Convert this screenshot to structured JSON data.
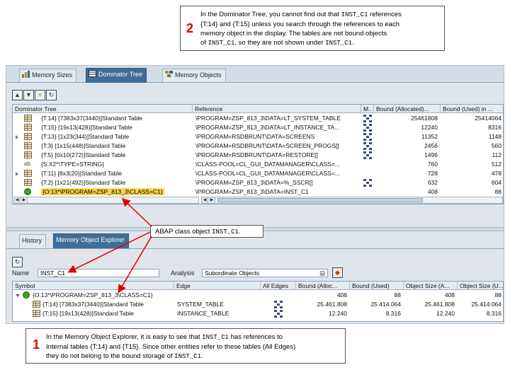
{
  "callout_top": {
    "number": "2",
    "lines": [
      [
        "In the Dominator Tree, you cannot find out that ",
        {
          "mono": "INST_C1"
        },
        " references"
      ],
      [
        "{T:14} and {T:15} unless you search through the references to each"
      ],
      [
        "memory object in the display. The tables are not bound objects"
      ],
      [
        "of ",
        {
          "mono": "INST_C1"
        },
        ", so they are not shown under ",
        {
          "mono": "INST_C1"
        },
        "."
      ]
    ]
  },
  "callout_middle": {
    "lines": [
      [
        "ABAP class object ",
        {
          "mono": "INST_C1"
        },
        "."
      ]
    ]
  },
  "callout_bottom": {
    "number": "1",
    "lines": [
      [
        "In the Memory Object Explorer, it is easy to see that ",
        {
          "mono": "INST_C1"
        },
        " has references to"
      ],
      [
        "Internal tables {T:14} and {T15}.  Since other entities refer to these tables (All Edges)"
      ],
      [
        "they do not belong to the bound storage of  ",
        {
          "mono": "INST_C1"
        },
        "."
      ]
    ]
  },
  "top_tabs": [
    {
      "label": "Memory Sizes",
      "active": false
    },
    {
      "label": "Dominator Tree",
      "active": true
    },
    {
      "label": "Memory Objects",
      "active": false
    }
  ],
  "dominator": {
    "headers": [
      "Dominator Tree",
      "Reference",
      "M..",
      "Bound (Allocated)...",
      "Bound (Used) in ..."
    ],
    "rows": [
      {
        "icon": "table",
        "expand": false,
        "name": "{T:14} [7383x37(3440)]Standard Table",
        "ref": "\\PROGRAM=ZSP_813_3\\DATA=LT_SYSTEM_TABLE",
        "net": true,
        "alloc": "25461808",
        "used": "25414064"
      },
      {
        "icon": "table",
        "expand": false,
        "name": "{T:15} [19x13(428)]Standard Table",
        "ref": "\\PROGRAM=ZSP_813_3\\DATA=LT_INSTANCE_TA...",
        "net": true,
        "alloc": "12240",
        "used": "8316"
      },
      {
        "icon": "table",
        "expand": true,
        "name": "{T:13} [1x23(344)]Standard Table",
        "ref": "\\PROGRAM=RSDBRUNT\\DATA=SCREENS",
        "net": true,
        "alloc": "11352",
        "used": "1148"
      },
      {
        "icon": "table",
        "expand": false,
        "name": "{T:3} [1x15(448)]Standard Table",
        "ref": "\\PROGRAM=RSDBRUNT\\DATA=SCREEN_PROGS[]",
        "net": true,
        "alloc": "2456",
        "used": "560"
      },
      {
        "icon": "table",
        "expand": false,
        "name": "{T:5} [0x10(272)]Standard Table",
        "ref": "\\PROGRAM=RSDBRUNT\\DATA=RESTORE[]",
        "net": true,
        "alloc": "1496",
        "used": "112"
      },
      {
        "icon": "string",
        "expand": false,
        "name": "{S:X2*\\TYPE=STRING}",
        "ref": "\\CLASS-POOL=CL_GUI_DATAMANAGER\\CLASS=...",
        "net": false,
        "alloc": "760",
        "used": "512"
      },
      {
        "icon": "table",
        "expand": true,
        "name": "{T:11} [8x3(20)]Standard Table",
        "ref": "\\CLASS-POOL=CL_GUI_DATAMANAGER\\CLASS=...",
        "net": false,
        "alloc": "728",
        "used": "478"
      },
      {
        "icon": "table",
        "expand": false,
        "name": "{T:2} [1x21(492)]Standard Table",
        "ref": "\\PROGRAM=ZSP_813_3\\DATA=%_SSCR[]",
        "net": true,
        "alloc": "632",
        "used": "604"
      },
      {
        "icon": "object",
        "expand": false,
        "highlight": true,
        "name": "{O:13*\\PROGRAM=ZSP_813_3\\CLASS=C1}",
        "ref": "\\PROGRAM=ZSP_813_3\\DATA=INST_C1",
        "net": false,
        "alloc": "408",
        "used": "88"
      }
    ]
  },
  "bottom_tabs": [
    {
      "label": "History",
      "active": false
    },
    {
      "label": "Memory Object Explorer",
      "active": true
    }
  ],
  "explorer": {
    "name_label": "Name",
    "name_value": "INST_C1",
    "analysis_label": "Analysis",
    "analysis_value": "Subordinate Objects",
    "headers": [
      "Symbol",
      "Edge",
      "All Edges",
      "Bound (Alloc...",
      "Bound (Used)",
      "Object Size (A...",
      "Object Size (U..."
    ],
    "rows": [
      {
        "level": 0,
        "icon": "object",
        "name": "{O:13*\\PROGRAM=ZSP_813_3\\CLASS=C1}",
        "edge": "",
        "net": false,
        "alloc": "408",
        "used": "88",
        "osa": "408",
        "osu": "88"
      },
      {
        "level": 1,
        "icon": "table",
        "name": "{T:14} [7383x37(3440)]Standard Table",
        "edge": "SYSTEM_TABLE",
        "net": true,
        "alloc": "25.461.808",
        "used": "25.414.064",
        "osa": "25.461.808",
        "osu": "25.414.064"
      },
      {
        "level": 1,
        "icon": "table",
        "name": "{T:15} [19x13(428)]Standard Table",
        "edge": "INSTANCE_TABLE",
        "net": true,
        "alloc": "12.240",
        "used": "8.316",
        "osa": "12.240",
        "osu": "8.316"
      }
    ]
  },
  "colors": {
    "annotation_red": "#e00000",
    "arrow_red": "#e00000",
    "highlight": "#f7d64a",
    "tab_active": "#3f6d97"
  }
}
